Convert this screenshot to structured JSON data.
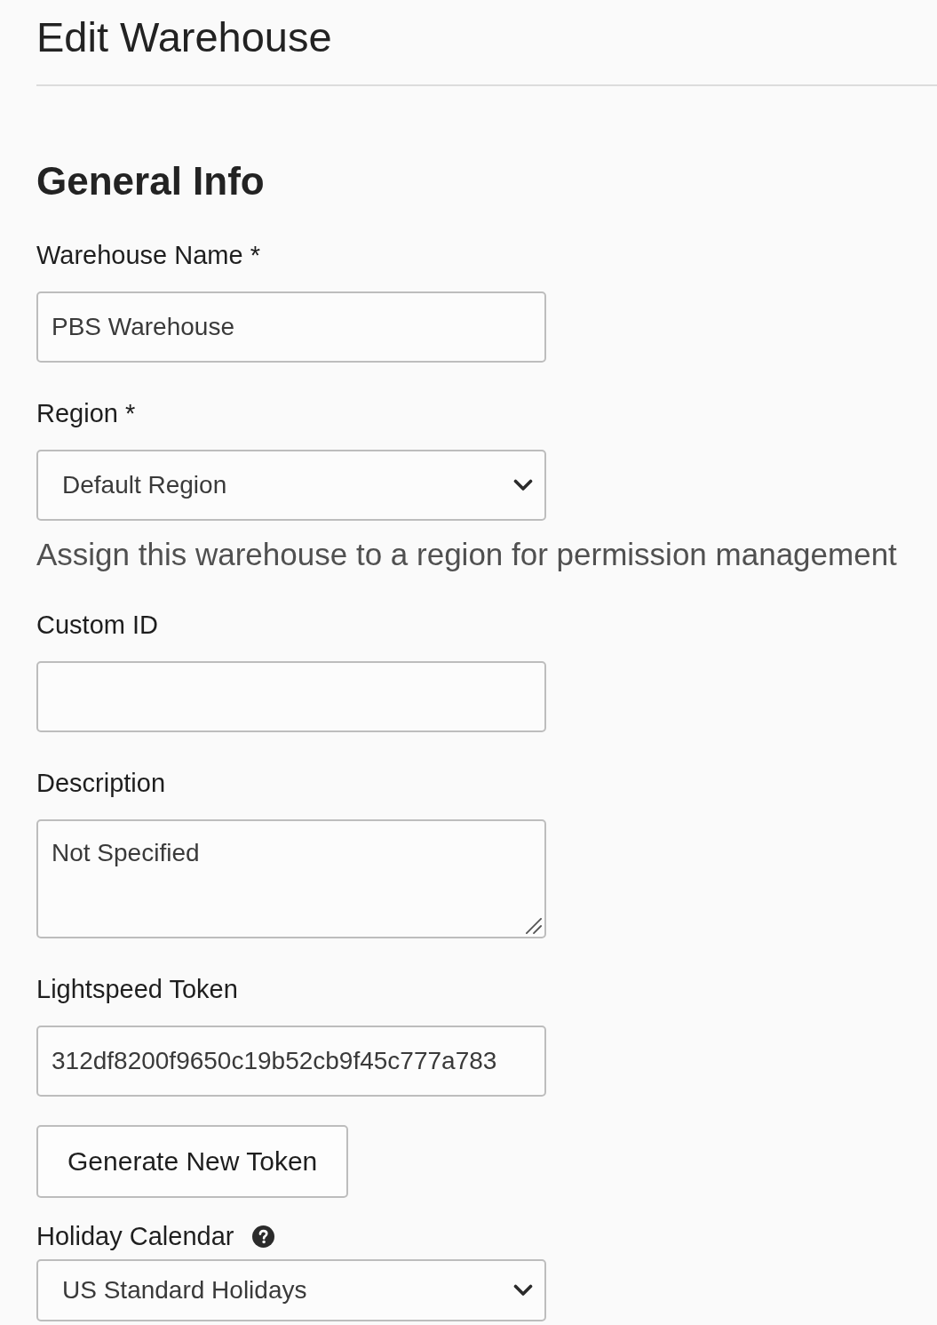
{
  "page": {
    "title": "Edit Warehouse"
  },
  "section": {
    "heading": "General Info"
  },
  "fields": [
    {
      "kind": "text",
      "label": "Warehouse Name *",
      "value": "PBS Warehouse"
    },
    {
      "kind": "select",
      "label": "Region *",
      "value": "Default Region",
      "help_text": "Assign this warehouse to a region for permission management"
    },
    {
      "kind": "text",
      "label": "Custom ID"
    },
    {
      "kind": "textarea",
      "label": "Description",
      "value": "Not Specified"
    },
    {
      "kind": "text",
      "label": "Lightspeed Token",
      "value": "312df8200f9650c19b52cb9f45c777a783"
    },
    {
      "kind": "button",
      "label": "Generate New Token"
    },
    {
      "kind": "select",
      "label": "Holiday Calendar",
      "value": "US Standard Holidays",
      "help_icon": true
    }
  ]
}
